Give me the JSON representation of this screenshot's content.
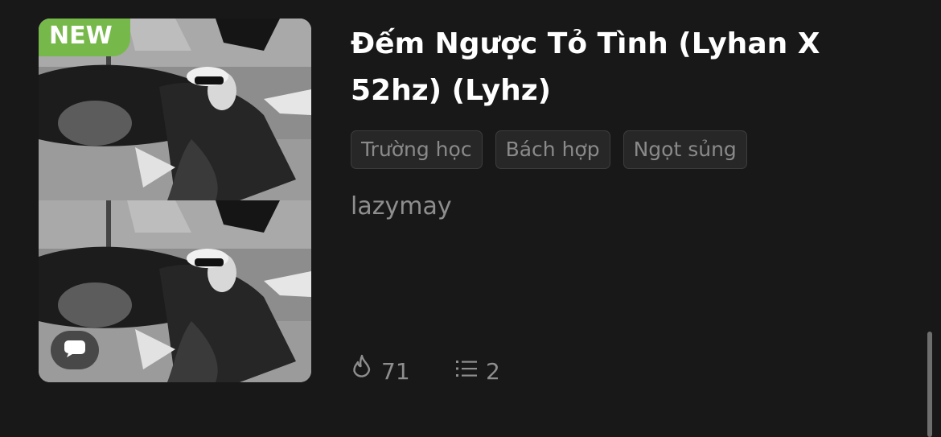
{
  "book": {
    "badge": "NEW",
    "title": "Đếm Ngược Tỏ Tình (Lyhan X 52hz) (Lyhz)",
    "tags": [
      "Trường học",
      "Bách hợp",
      "Ngọt sủng"
    ],
    "author": "lazymay",
    "views": "71",
    "chapters": "2"
  },
  "icons": {
    "cover_chat": "chat-bubble-icon",
    "views": "flame-icon",
    "chapters": "list-icon"
  },
  "colors": {
    "background": "#181818",
    "badge": "#76b94a",
    "title": "#ffffff",
    "muted_text": "#8e8e8e",
    "tag_background": "#272727"
  }
}
